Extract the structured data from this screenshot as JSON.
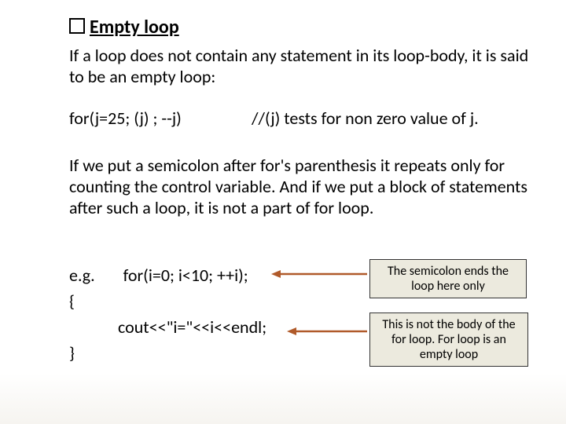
{
  "title": "Empty loop",
  "para1": "If a loop does not contain any statement in its loop-body, it is said to be an empty loop:",
  "for_line_left": "for(j=25; (j)   ; --j)",
  "for_line_right": "//(j) tests for non zero value of j.",
  "para2": "If we put a semicolon after for's parenthesis it repeats only for counting  the control variable. And if we put a block of statements after such a loop, it is not a part of for loop.",
  "example": {
    "eg": "e.g.",
    "for": "for(i=0; i<10; ++i);",
    "open": "{",
    "cout": "cout<<\"i=\"<<i<<endl;",
    "close": "}"
  },
  "note1": "The semicolon ends the loop here only",
  "note2": "This is not the body of the for loop. For loop is an empty loop"
}
